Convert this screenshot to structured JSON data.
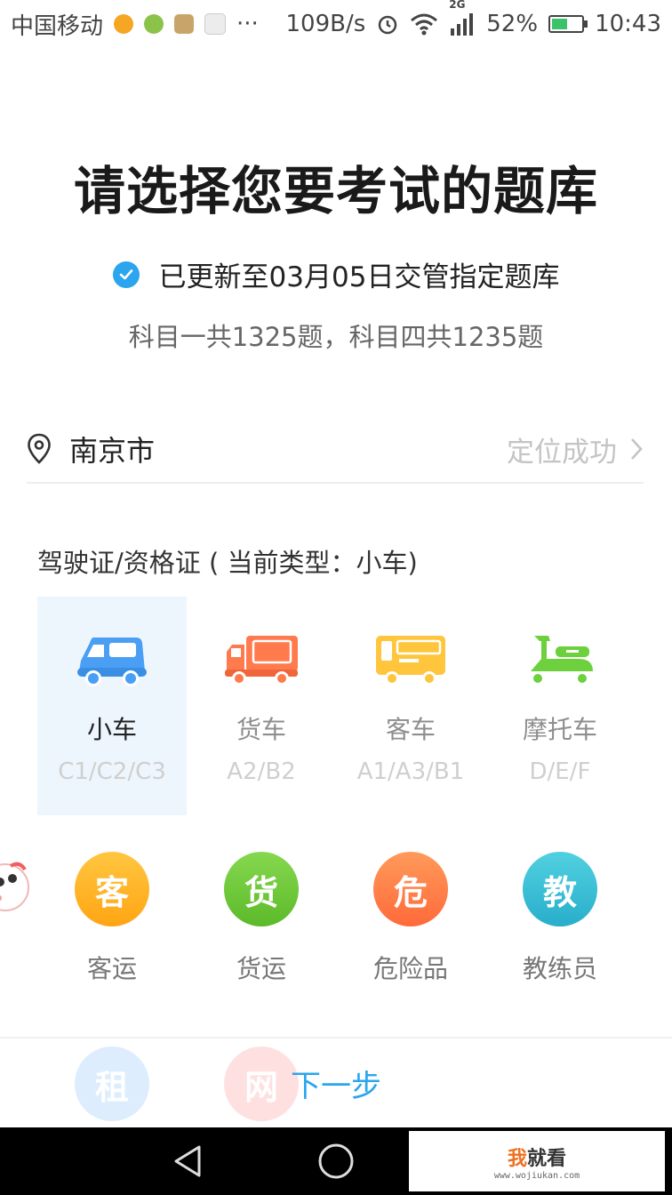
{
  "status_bar": {
    "carrier": "中国移动",
    "more": "···",
    "speed": "109B/s",
    "network": "2G",
    "battery": "52%",
    "battery_level": 0.52,
    "time": "10:43"
  },
  "header": {
    "title": "请选择您要考试的题库",
    "update_text": "已更新至03月05日交管指定题库",
    "subtitle": "科目一共1325题，科目四共1235题"
  },
  "location": {
    "city": "南京市",
    "status": "定位成功"
  },
  "section": {
    "label": "驾驶证/资格证 ( 当前类型：小车)"
  },
  "vehicles": [
    {
      "name": "小车",
      "code": "C1/C2/C3",
      "color": "#4a9ff5",
      "icon": "car-icon",
      "selected": true
    },
    {
      "name": "货车",
      "code": "A2/B2",
      "color": "#ff7a4d",
      "icon": "truck-icon",
      "selected": false
    },
    {
      "name": "客车",
      "code": "A1/A3/B1",
      "color": "#ffc53d",
      "icon": "bus-icon",
      "selected": false
    },
    {
      "name": "摩托车",
      "code": "D/E/F",
      "color": "#6cd13c",
      "icon": "motorcycle-icon",
      "selected": false
    }
  ],
  "qualifications": [
    {
      "char": "客",
      "name": "客运",
      "color": "#ffb22a"
    },
    {
      "char": "货",
      "name": "货运",
      "color": "#6cc93a"
    },
    {
      "char": "危",
      "name": "危险品",
      "color": "#ff7a4d"
    },
    {
      "char": "教",
      "name": "教练员",
      "color": "#3cc0d6"
    }
  ],
  "qualifications_more": [
    {
      "char": "租",
      "color": "#4a9ff5"
    },
    {
      "char": "网",
      "color": "#ff5a5a"
    }
  ],
  "next_button": "下一步",
  "watermark": {
    "part1": "我",
    "part2": "就看",
    "url": "www.wojiukan.com"
  },
  "colors": {
    "accent": "#2aa5ee",
    "selected_bg": "#eef6fd"
  }
}
